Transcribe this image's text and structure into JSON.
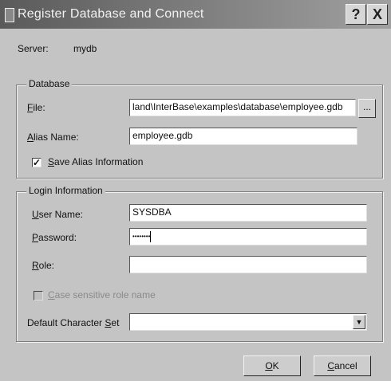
{
  "window": {
    "title": "Register Database and Connect",
    "help_label": "?",
    "close_label": "X"
  },
  "server": {
    "label": "Server:",
    "value": "mydb"
  },
  "database": {
    "group_title": "Database",
    "file_label_key": "F",
    "file_label_rest": "ile:",
    "file_value": "land\\InterBase\\examples\\database\\employee.gdb",
    "browse_label": "...",
    "alias_label_key": "A",
    "alias_label_rest": "lias Name:",
    "alias_value": "employee.gdb",
    "save_alias_key": "S",
    "save_alias_rest": "ave Alias Information",
    "save_alias_checked": true
  },
  "login": {
    "group_title": "Login Information",
    "user_label_key": "U",
    "user_label_rest": "ser Name:",
    "user_value": "SYSDBA",
    "password_label_key": "P",
    "password_label_rest": "assword:",
    "password_value": "••••••••",
    "role_label_key": "R",
    "role_label_rest": "ole:",
    "role_value": "",
    "case_key": "C",
    "case_rest": "ase sensitive role name",
    "case_checked": false
  },
  "charset": {
    "label_main": "Default Character ",
    "label_key": "S",
    "label_rest": "et",
    "value": ""
  },
  "buttons": {
    "ok_key": "O",
    "ok_rest": "K",
    "cancel_key": "C",
    "cancel_rest": "ancel"
  }
}
